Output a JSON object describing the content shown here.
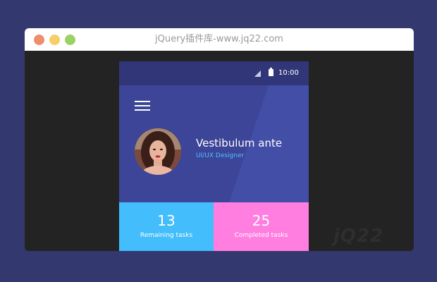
{
  "window": {
    "title": "jQuery插件库-www.jq22.com"
  },
  "statusbar": {
    "time": "10:00",
    "signal_icon": "signal-icon",
    "battery_icon": "battery-icon"
  },
  "profile": {
    "menu_icon": "hamburger-menu-icon",
    "name": "Vestibulum ante",
    "role": "UI/UX Designer"
  },
  "stats": [
    {
      "value": "13",
      "label": "Remaining tasks",
      "color": "#43bdfb"
    },
    {
      "value": "25",
      "label": "Completed tasks",
      "color": "#ff7ee0"
    }
  ],
  "colors": {
    "page_background": "#33386e",
    "statusbar": "#313679",
    "profile_background": "#3d4598",
    "accent_text": "#4fc1ff"
  }
}
